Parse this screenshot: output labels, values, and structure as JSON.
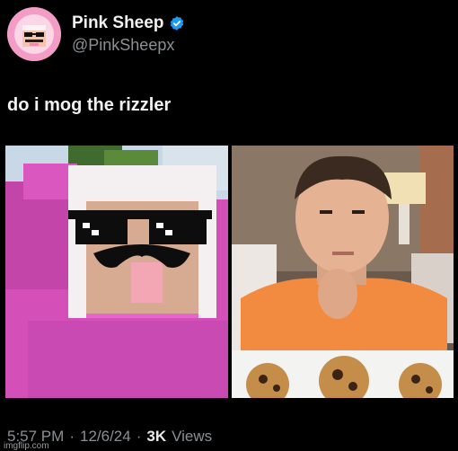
{
  "post": {
    "author": {
      "display_name": "Pink Sheep",
      "handle": "@PinkSheepx",
      "verified": true,
      "avatar_icon": "pink-sheep-avatar-icon",
      "verified_color": "#1d9bf0"
    },
    "text": "do i mog the rizzler",
    "media": [
      {
        "description_icon": "pink-sheep-minecraft-image"
      },
      {
        "description_icon": "boy-with-cookies-photo"
      }
    ],
    "time": "5:57 PM",
    "separator": "·",
    "date": "12/6/24",
    "views_count": "3K",
    "views_label": "Views"
  },
  "watermark": "imgflip.com"
}
